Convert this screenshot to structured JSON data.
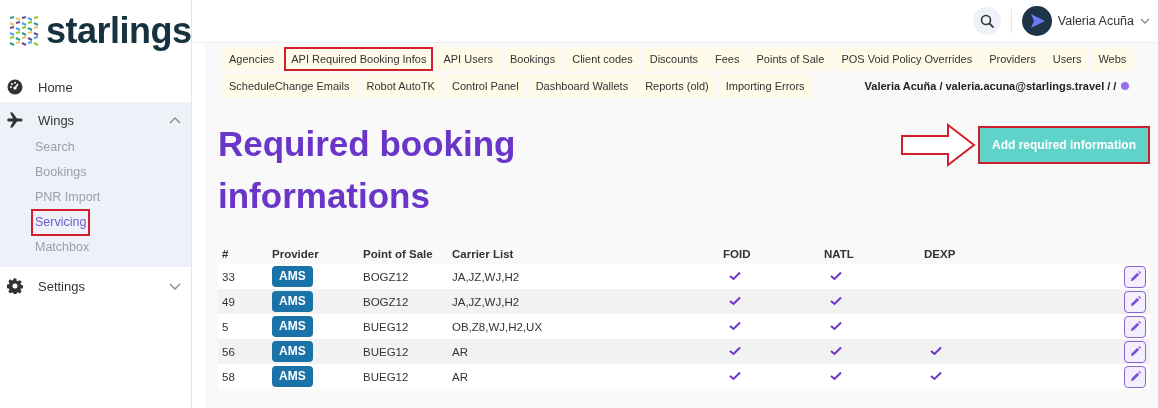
{
  "brand": {
    "name": "starlings"
  },
  "header": {
    "user_name": "Valeria Acuña"
  },
  "sidebar": {
    "items": [
      {
        "kind": "link",
        "label": "Home"
      },
      {
        "kind": "group",
        "label": "Wings",
        "expanded": true,
        "children": [
          {
            "label": "Search",
            "selected": false,
            "highlighted": false
          },
          {
            "label": "Bookings",
            "selected": false,
            "highlighted": false
          },
          {
            "label": "PNR Import",
            "selected": false,
            "highlighted": false
          },
          {
            "label": "Servicing",
            "selected": true,
            "highlighted": true
          },
          {
            "label": "Matchbox",
            "selected": false,
            "highlighted": false
          }
        ]
      },
      {
        "kind": "group",
        "label": "Settings",
        "expanded": false
      }
    ]
  },
  "tabs": [
    [
      {
        "label": "Agencies",
        "highlighted": false
      },
      {
        "label": "API Required Booking Infos",
        "highlighted": true
      },
      {
        "label": "API Users",
        "highlighted": false
      },
      {
        "label": "Bookings",
        "highlighted": false
      },
      {
        "label": "Client codes",
        "highlighted": false
      },
      {
        "label": "Discounts",
        "highlighted": false
      },
      {
        "label": "Fees",
        "highlighted": false
      },
      {
        "label": "Points of Sale",
        "highlighted": false
      },
      {
        "label": "POS Void Policy Overrides",
        "highlighted": false
      },
      {
        "label": "Providers",
        "highlighted": false
      },
      {
        "label": "Users",
        "highlighted": false
      },
      {
        "label": "Webs",
        "highlighted": false
      }
    ],
    [
      {
        "label": "ScheduleChange Emails",
        "highlighted": false
      },
      {
        "label": "Robot AutoTK",
        "highlighted": false
      },
      {
        "label": "Control Panel",
        "highlighted": false
      },
      {
        "label": "Dashboard Wallets",
        "highlighted": false
      },
      {
        "label": "Reports (old)",
        "highlighted": false
      },
      {
        "label": "Importing Errors",
        "highlighted": false
      }
    ]
  ],
  "session": {
    "text": "Valeria Acuña / valeria.acuna@starlings.travel / /",
    "color": "#9b6ef0"
  },
  "page": {
    "title": "Required booking informations",
    "add_button": {
      "label": "Add required information",
      "highlighted": true,
      "callout_arrow": true
    }
  },
  "table": {
    "columns": [
      "#",
      "Provider",
      "Point of Sale",
      "Carrier List",
      "FOID",
      "NATL",
      "DEXP"
    ],
    "rows": [
      {
        "id": "33",
        "provider": "AMS",
        "point_of_sale": "BOGZ12",
        "carriers": "JA,JZ,WJ,H2",
        "foid": true,
        "natl": true,
        "dexp": false
      },
      {
        "id": "49",
        "provider": "AMS",
        "point_of_sale": "BOGZ12",
        "carriers": "JA,JZ,WJ,H2",
        "foid": true,
        "natl": true,
        "dexp": false
      },
      {
        "id": "5",
        "provider": "AMS",
        "point_of_sale": "BUEG12",
        "carriers": "OB,Z8,WJ,H2,UX",
        "foid": true,
        "natl": true,
        "dexp": false
      },
      {
        "id": "56",
        "provider": "AMS",
        "point_of_sale": "BUEG12",
        "carriers": "AR",
        "foid": true,
        "natl": true,
        "dexp": true
      },
      {
        "id": "58",
        "provider": "AMS",
        "point_of_sale": "BUEG12",
        "carriers": "AR",
        "foid": true,
        "natl": true,
        "dexp": true
      }
    ]
  }
}
